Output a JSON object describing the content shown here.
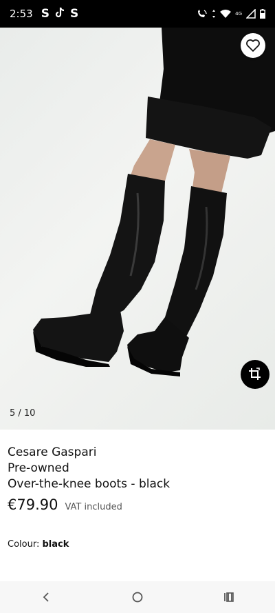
{
  "status_bar": {
    "time": "2:53",
    "notification_icons": [
      "S",
      "tiktok-icon",
      "S"
    ],
    "system_icons": [
      "wifi-call-icon",
      "wifi-icon",
      "signal-icon",
      "battery-icon"
    ],
    "network_label": "4G"
  },
  "gallery": {
    "counter": "5 / 10",
    "favourite_icon": "heart-icon",
    "swap_icon": "crop-rotate-icon"
  },
  "product": {
    "brand": "Cesare Gaspari",
    "condition": "Pre-owned",
    "name": "Over-the-knee boots - black",
    "price": "€79.90",
    "vat_note": "VAT included",
    "colour_label": "Colour:",
    "colour_value": "black"
  },
  "nav_bar": {
    "buttons": [
      "back-icon",
      "home-icon",
      "recents-icon"
    ]
  },
  "colors": {
    "status_bar_bg": "#000000",
    "accent": "#000000",
    "text": "#111111"
  }
}
